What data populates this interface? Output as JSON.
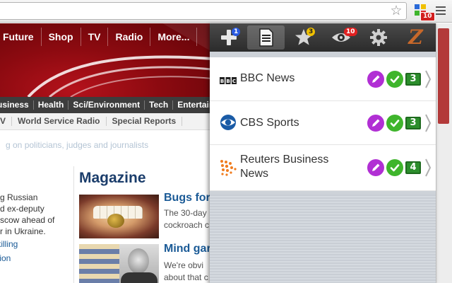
{
  "browser": {
    "extension_badge": "10"
  },
  "website": {
    "main_nav": [
      "Future",
      "Shop",
      "TV",
      "Radio",
      "More..."
    ],
    "sub_nav": [
      "usiness",
      "Health",
      "Sci/Environment",
      "Tech",
      "Entertain"
    ],
    "sub_nav2": [
      "V",
      "World Service Radio",
      "Special Reports"
    ],
    "ticker": "g on politicians, judges and journalists",
    "left_story": {
      "lines": [
        "g Russian",
        "d ex-deputy",
        "scow ahead of",
        "r in Ukraine."
      ],
      "links": [
        "s killing",
        "tion"
      ]
    },
    "magazine": {
      "title": "Magazine",
      "story1": {
        "headline": "Bugs for",
        "lines": [
          "The 30-day",
          "cockroach c"
        ]
      },
      "story2": {
        "headline": "Mind gar",
        "lines": [
          "We're obvi",
          "about that c"
        ]
      }
    }
  },
  "popup": {
    "tabs": [
      {
        "name": "add",
        "badge": "1",
        "badge_color": "blue"
      },
      {
        "name": "feeds",
        "badge": "",
        "active": true
      },
      {
        "name": "favorites",
        "badge": "3",
        "badge_color": "yellow"
      },
      {
        "name": "watch",
        "badge": "10",
        "badge_color": "red"
      },
      {
        "name": "settings",
        "badge": ""
      },
      {
        "name": "z-logo",
        "text": "Z"
      }
    ],
    "feeds": [
      {
        "logo": "bbc-logo",
        "logo_text": "BBC",
        "title": "BBC News",
        "count": "3"
      },
      {
        "logo": "cbs-eye-logo",
        "title": "CBS Sports",
        "count": "3"
      },
      {
        "logo": "reuters-logo",
        "title_line1": "Reuters Business",
        "title_line2": "News",
        "count": "4"
      }
    ],
    "colors": {
      "edit": "#b12fd4",
      "check": "#3fb52c",
      "count": "#2c8e2c",
      "accent_z": "#c8682a"
    }
  }
}
